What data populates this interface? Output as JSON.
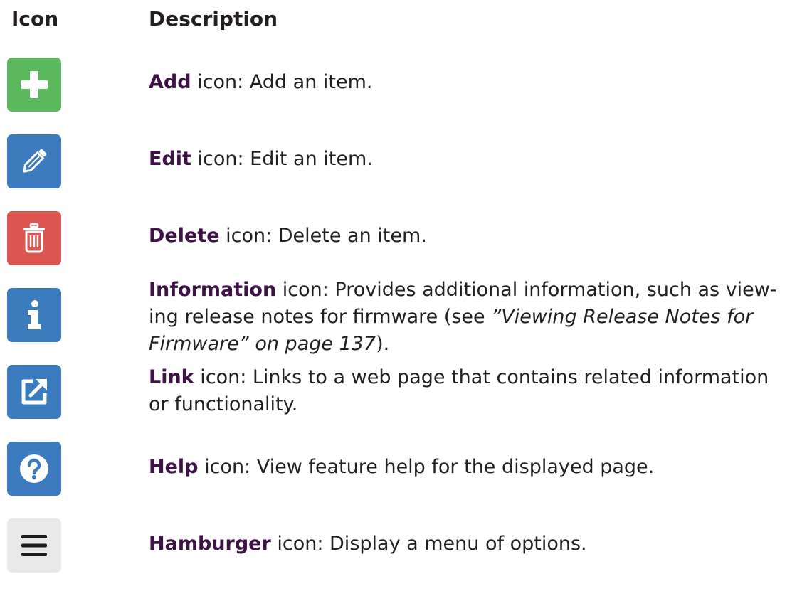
{
  "table": {
    "col_icon": "Icon",
    "col_description": "Description"
  },
  "rows": [
    {
      "icon": "plus-icon",
      "color": "#5cb85c",
      "term": "Add",
      "text": " icon: Add an item."
    },
    {
      "icon": "pencil-icon",
      "color": "#3d7bbf",
      "term": "Edit",
      "text": " icon: Edit an item."
    },
    {
      "icon": "trash-icon",
      "color": "#dc5550",
      "term": "Delete",
      "text": " icon: Delete an item."
    },
    {
      "icon": "info-icon",
      "color": "#3d7bbf",
      "term": "Information",
      "text_before": " icon: Provides additional information, such as view-ing release notes for firmware (see ",
      "xref": "”Viewing Release Notes for Firmware” on page 137",
      "text_after": ")."
    },
    {
      "icon": "external-link-icon",
      "color": "#3d7bbf",
      "term": "Link",
      "text": " icon: Links to a web page that contains related information or functionality."
    },
    {
      "icon": "question-icon",
      "color": "#3d7bbf",
      "term": "Help",
      "text": " icon: View feature help for the displayed page."
    },
    {
      "icon": "hamburger-icon",
      "color": "#e8e8e8",
      "term": "Hamburger",
      "text": " icon: Display a menu of options."
    }
  ]
}
